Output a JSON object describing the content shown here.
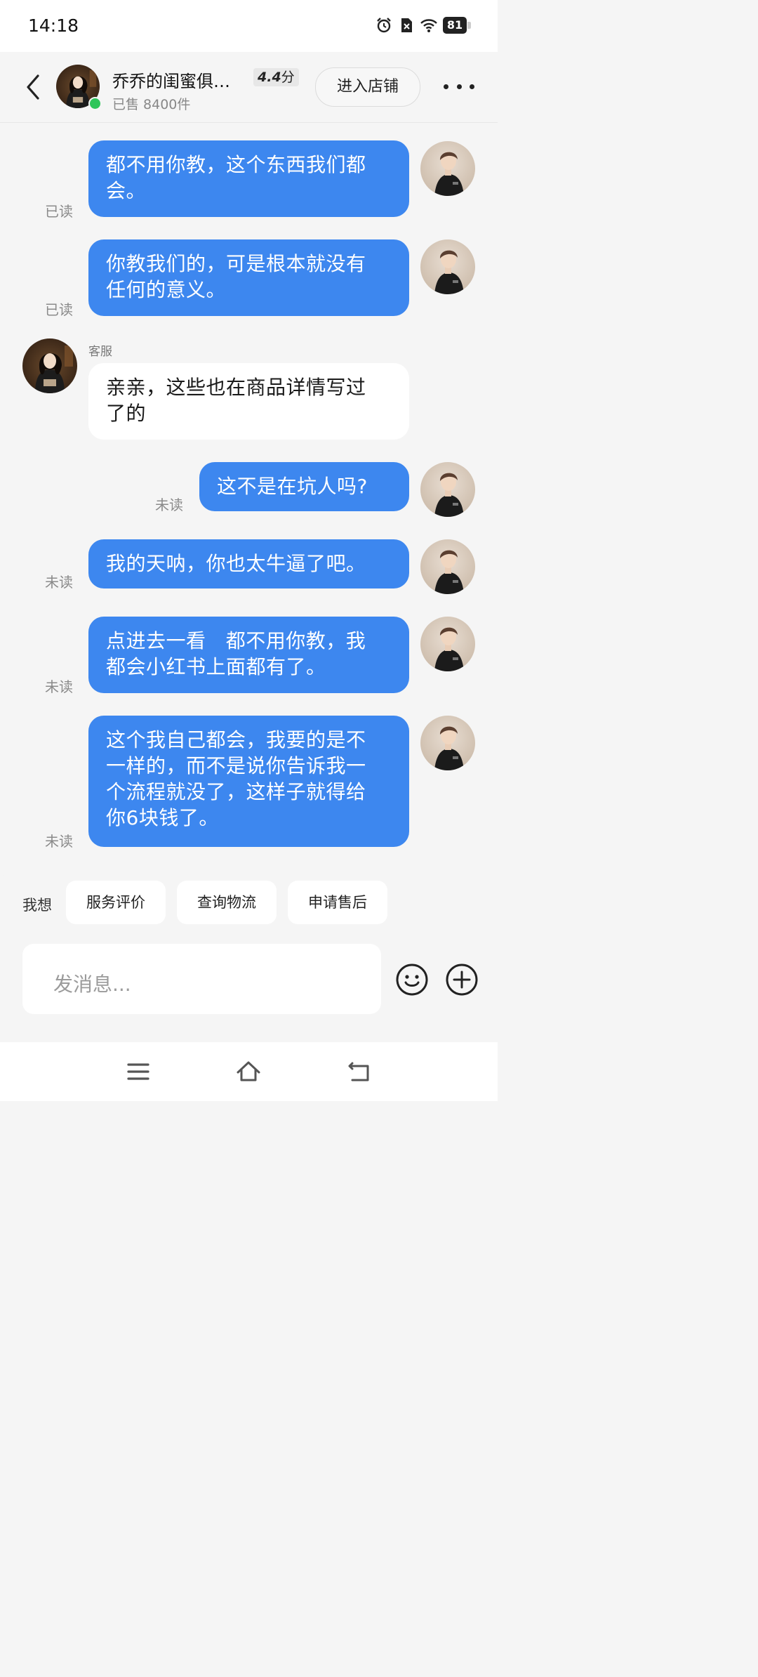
{
  "status_bar": {
    "time": "14:18",
    "battery": "81",
    "icons": [
      "alarm-icon",
      "no-sim-icon",
      "wifi-icon",
      "battery-icon"
    ]
  },
  "header": {
    "shop_name": "乔乔的闺蜜俱…",
    "rating_value": "4.4",
    "rating_unit": "分",
    "sold": "已售 8400件",
    "enter_shop": "进入店铺"
  },
  "messages": [
    {
      "role": "me",
      "lines": [
        "都不用你教，这个东西我们都",
        "会。"
      ],
      "status": "已读"
    },
    {
      "role": "me",
      "lines": [
        "你教我们的，可是根本就没有",
        "任何的意义。"
      ],
      "status": "已读"
    },
    {
      "role": "agent",
      "sender": "客服",
      "lines": [
        "亲亲，这些也在商品详情写过",
        "了的"
      ]
    },
    {
      "role": "me",
      "lines": [
        "这不是在坑人吗?"
      ],
      "status": "未读"
    },
    {
      "role": "me",
      "lines": [
        "我的天呐，你也太牛逼了吧。"
      ],
      "status": "未读"
    },
    {
      "role": "me",
      "lines": [
        "点进去一看   都不用你教，我",
        "都会小红书上面都有了。"
      ],
      "status": "未读"
    },
    {
      "role": "me",
      "lines": [
        "这个我自己都会，我要的是不",
        "一样的，而不是说你告诉我一",
        "个流程就没了，这样子就得给",
        "你6块钱了。"
      ],
      "status": "未读"
    }
  ],
  "quick_actions": {
    "label": "我想",
    "chips": [
      "服务评价",
      "查询物流",
      "申请售后"
    ]
  },
  "composer": {
    "placeholder": "发消息..."
  },
  "nav": {
    "icons": [
      "menu-icon",
      "home-icon",
      "back-nav-icon"
    ]
  },
  "colors": {
    "outgoing_bubble": "#3d87ef",
    "incoming_bubble": "#ffffff",
    "background": "#f5f5f5",
    "online": "#2ec55a"
  }
}
